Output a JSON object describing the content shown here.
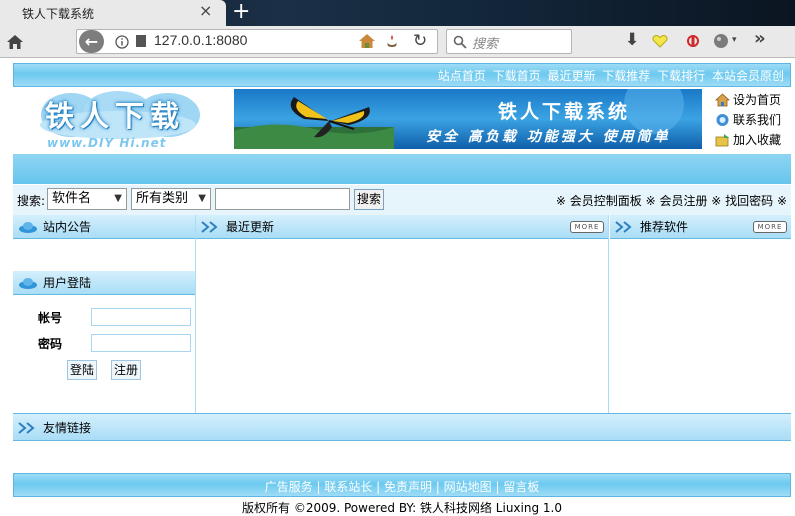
{
  "browser": {
    "tab_title": "铁人下载系统",
    "tab_close": "×",
    "new_tab": "+",
    "url": "127.0.0.1:8080",
    "search_placeholder": "搜索"
  },
  "header": {
    "top_nav": [
      "站点首页",
      "下载首页",
      "最近更新",
      "下载推荐",
      "下载排行",
      "本站会员原创"
    ],
    "logo_text": "铁人下载",
    "logo_url": "www.DIY Hi.net",
    "banner_title": "铁人下载系统",
    "banner_subtitle": "安全 高负载 功能强大 使用简单",
    "side_links": [
      {
        "label": "设为首页",
        "icon": "home-icon"
      },
      {
        "label": "联系我们",
        "icon": "contact-icon"
      },
      {
        "label": "加入收藏",
        "icon": "favorite-icon"
      }
    ]
  },
  "search": {
    "label": "搜索:",
    "field_select": "软件名",
    "category_select": "所有类别",
    "keyword": "",
    "button": "搜索",
    "member_links": "※ 会员控制面板 ※ 会员注册 ※ 找回密码 ※"
  },
  "panels": {
    "notice": "站内公告",
    "login": "用户登陆",
    "recent": "最近更新",
    "recommend": "推荐软件",
    "more": "MORE",
    "friend_links": "友情链接"
  },
  "login": {
    "account_label": "帐号",
    "password_label": "密码",
    "login_button": "登陆",
    "register_button": "注册"
  },
  "footer": {
    "links": "广告服务 | 联系站长 | 免责声明 | 网站地图 | 留言板",
    "copyright": "版权所有 ©2009. Powered BY: 铁人科技网络 Liuxing 1.0"
  }
}
